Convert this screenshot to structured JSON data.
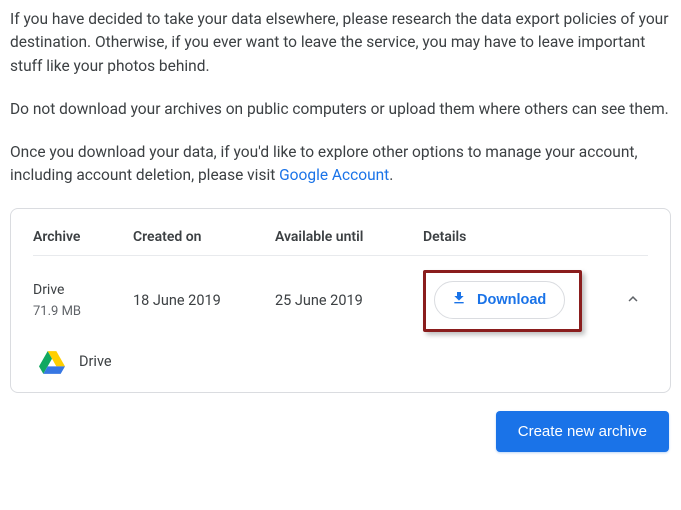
{
  "intro": {
    "p1": "If you have decided to take your data elsewhere, please research the data export policies of your destination. Otherwise, if you ever want to leave the service, you may have to leave important stuff like your photos behind.",
    "p2": "Do not download your archives on public computers or upload them where others can see them.",
    "p3_a": "Once you download your data, if you'd like to explore other options to manage your account, including account deletion, please visit ",
    "p3_link": "Google Account",
    "p3_b": "."
  },
  "table": {
    "headers": {
      "archive": "Archive",
      "created": "Created on",
      "available": "Available until",
      "details": "Details"
    },
    "row": {
      "name": "Drive",
      "size": "71.9 MB",
      "created": "18 June 2019",
      "available": "25 June 2019",
      "download_label": "Download"
    },
    "product": {
      "name": "Drive"
    }
  },
  "actions": {
    "create": "Create new archive"
  }
}
